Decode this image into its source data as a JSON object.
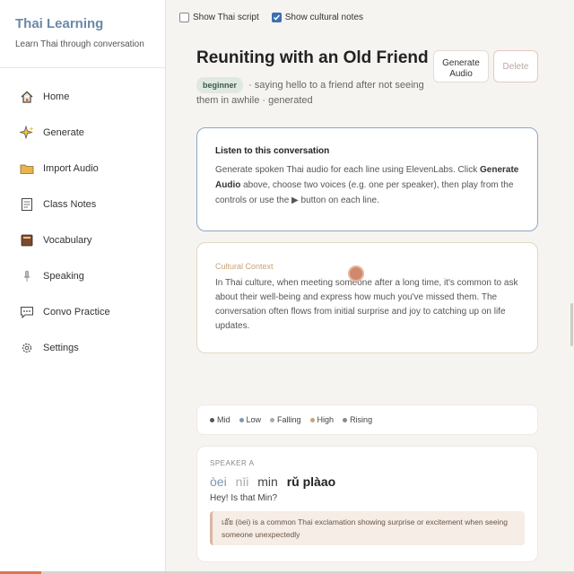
{
  "app": {
    "title": "Thai Learning",
    "subtitle": "Learn Thai through conversation"
  },
  "sidebar": {
    "items": [
      {
        "label": "Home",
        "icon": "home-icon"
      },
      {
        "label": "Generate",
        "icon": "sparkle-icon"
      },
      {
        "label": "Import Audio",
        "icon": "folder-icon"
      },
      {
        "label": "Class Notes",
        "icon": "notes-icon"
      },
      {
        "label": "Vocabulary",
        "icon": "book-icon"
      },
      {
        "label": "Speaking",
        "icon": "microphone-icon"
      },
      {
        "label": "Convo Practice",
        "icon": "chat-icon"
      },
      {
        "label": "Settings",
        "icon": "gear-icon"
      }
    ]
  },
  "toolbar": {
    "show_thai_script": {
      "label": "Show Thai script",
      "checked": false
    },
    "show_cultural_notes": {
      "label": "Show cultural notes",
      "checked": true
    }
  },
  "conversation": {
    "title": "Reuniting with an Old Friend",
    "level": "beginner",
    "description": "· saying hello to a friend after not seeing them in awhile · generated",
    "generate_label_1": "Generate",
    "generate_label_2": "Audio",
    "delete_label": "Delete"
  },
  "listen": {
    "heading": "Listen to this conversation",
    "text_1": "Generate spoken Thai audio for each line using ElevenLabs. Click ",
    "text_bold": "Generate Audio",
    "text_2": " above, choose two voices (e.g. one per speaker), then play from the controls or use the ▶ button on each line."
  },
  "cultural": {
    "heading": "Cultural Context",
    "text": "In Thai culture, when meeting someone after a long time, it's common to ask about their well-being and express how much you've missed them. The conversation often flows from initial surprise and joy to catching up on life updates."
  },
  "legend": [
    {
      "label": "Mid",
      "color": "#555555"
    },
    {
      "label": "Low",
      "color": "#7f96b3"
    },
    {
      "label": "Falling",
      "color": "#aaaaaa"
    },
    {
      "label": "High",
      "color": "#c7a277"
    },
    {
      "label": "Rising",
      "color": "#888888"
    }
  ],
  "lines": [
    {
      "speaker": "SPEAKER A",
      "words": [
        "òei",
        "nīi",
        "min",
        "rǔ plàao"
      ],
      "english": "Hey! Is that Min?",
      "note": "เอ๊ย (òei) is a common Thai exclamation showing surprise or excitement when seeing someone unexpectedly"
    }
  ],
  "colors": {
    "accent": "#6b88a8",
    "cultural": "#c7a277",
    "delete": "#e8c8c2"
  }
}
